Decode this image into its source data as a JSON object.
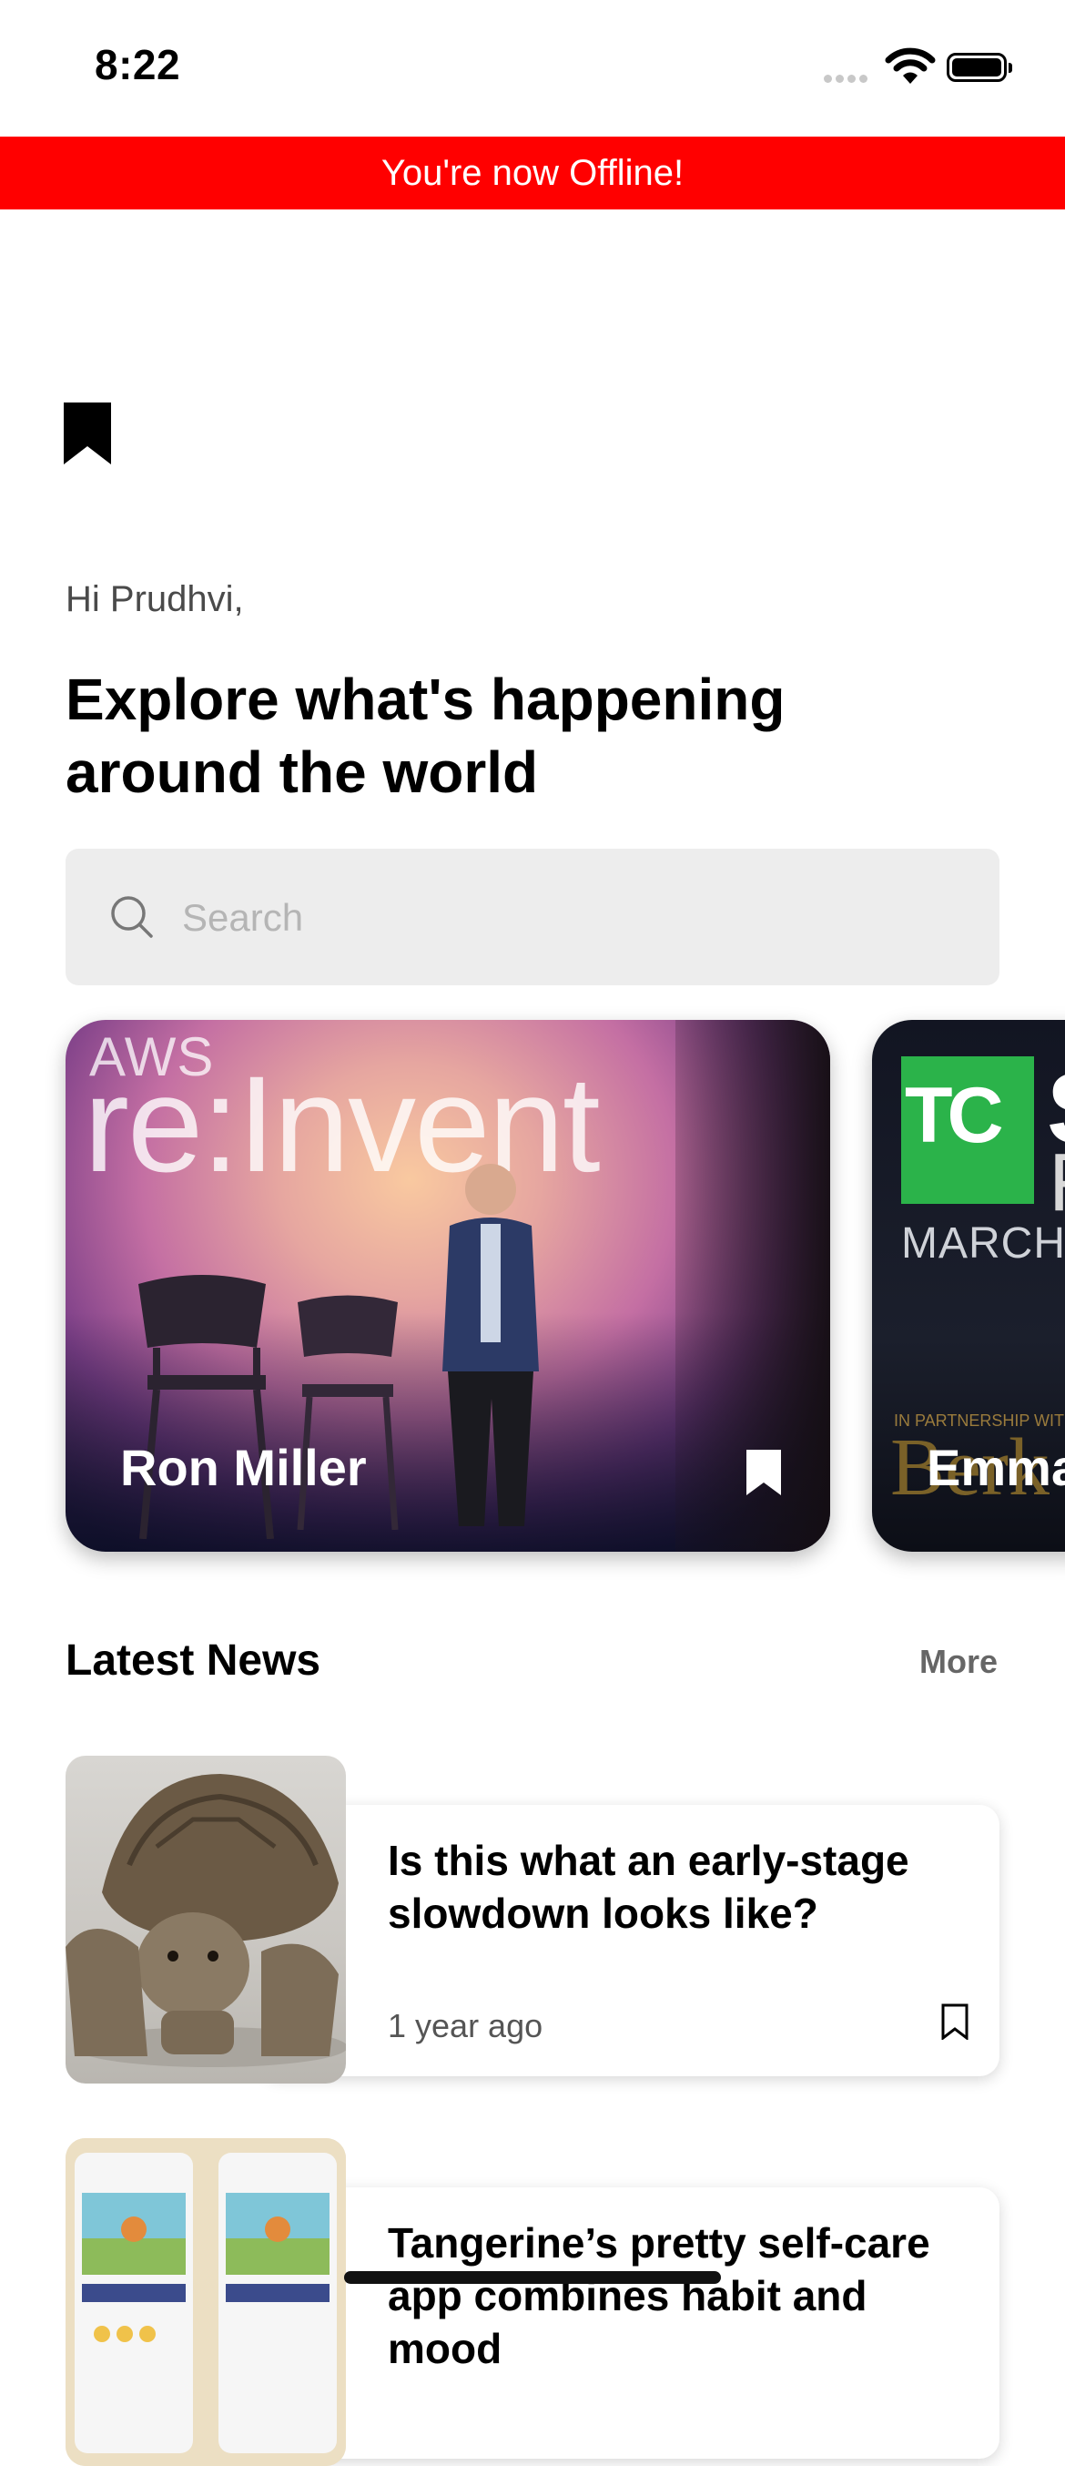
{
  "status_bar": {
    "time": "8:22"
  },
  "banner": {
    "text": "You're now Offline!",
    "color": "#ff0000"
  },
  "greeting": "Hi Prudhvi,",
  "headline": "Explore what's happening around the world",
  "search": {
    "placeholder": "Search",
    "value": ""
  },
  "featured": [
    {
      "author": "Ron Miller",
      "image_text_small": "AWS",
      "image_text_large": "re:Invent"
    },
    {
      "author": "Emma",
      "image_text_logo": "TC",
      "image_text_date": "MARCH",
      "image_text_partner": "IN PARTNERSHIP WITH",
      "image_text_sponsor": "Berk",
      "image_text_letter_s": "S",
      "image_text_letter_r": "R"
    }
  ],
  "latest_news": {
    "title": "Latest News",
    "more_label": "More",
    "items": [
      {
        "title": "Is this what an early-stage slowdown looks like?",
        "time": "1 year ago"
      },
      {
        "title": "Tangerine’s pretty self-care app combines habit and mood",
        "time": ""
      }
    ]
  },
  "icons": {
    "brand": "bookmark-icon",
    "search": "search-icon",
    "save": "bookmark-outline-icon"
  }
}
